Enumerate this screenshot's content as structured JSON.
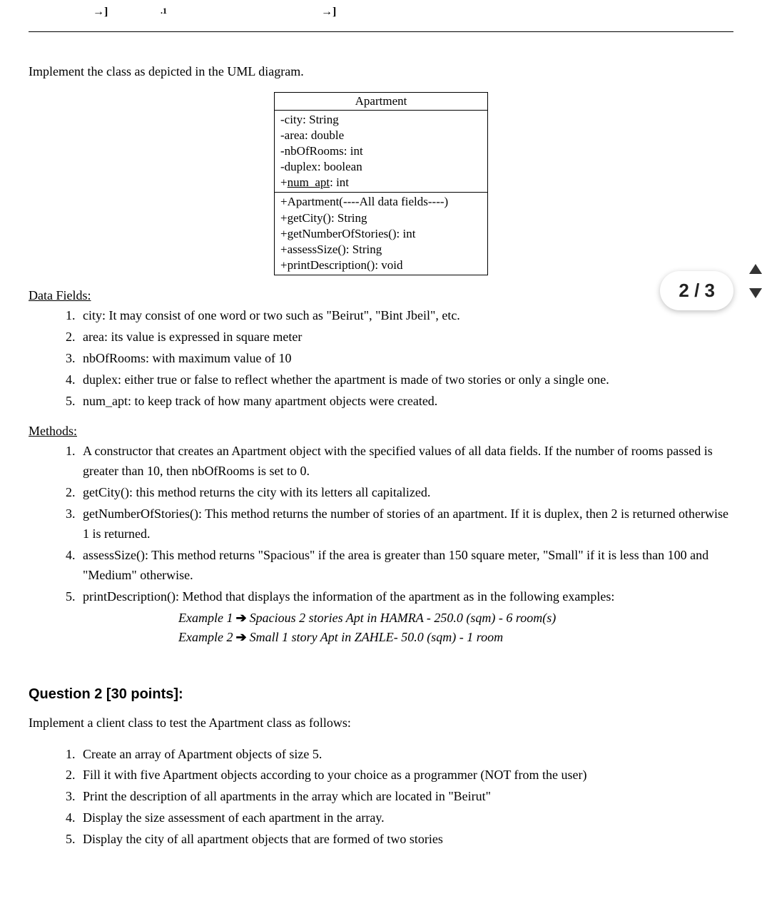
{
  "topbar": {
    "mark1": "→]",
    "mark2": ".1",
    "mark3": "→]"
  },
  "intro": "Implement the class as depicted in the UML diagram.",
  "uml": {
    "title": "Apartment",
    "fields": {
      "f1": "-city: String",
      "f2": "-area: double",
      "f3": "-nbOfRooms: int",
      "f4": "-duplex: boolean",
      "f5_pre": "+",
      "f5_under": "num_apt",
      "f5_post": ": int"
    },
    "methods": {
      "m1": "+Apartment(----All data fields----)",
      "m2": "+getCity(): String",
      "m3": "+getNumberOfStories(): int",
      "m4": "+assessSize(): String",
      "m5": "+printDescription(): void"
    }
  },
  "dataFields": {
    "heading": "Data Fields:",
    "items": {
      "1": "city: It may consist of one word or two such as \"Beirut\", \"Bint Jbeil\", etc.",
      "2": "area: its value is expressed in square meter",
      "3": "nbOfRooms: with maximum value of 10",
      "4": "duplex: either true or false to reflect whether the apartment is made of two stories or only a single one.",
      "5": "num_apt: to keep track of how many apartment objects were created."
    }
  },
  "methods": {
    "heading": "Methods:",
    "items": {
      "1": "A constructor that creates an Apartment object with the specified values of all data fields. If the number of rooms passed is greater than 10, then nbOfRooms is set to 0.",
      "2": "getCity(): this method returns the city with its letters all capitalized.",
      "3": "getNumberOfStories(): This method returns the number of stories of an apartment. If it is duplex, then 2 is returned otherwise 1 is returned.",
      "4": "assessSize(): This method returns \"Spacious\" if the area is greater than 150 square meter, \"Small\" if it is less than 100 and \"Medium\" otherwise.",
      "5": "printDescription(): Method that displays the information of the apartment as in the following examples:"
    },
    "ex1_label": "Example 1",
    "ex1_text": "Spacious 2 stories  Apt in HAMRA - 250.0 (sqm) - 6 room(s)",
    "ex2_label": "Example 2",
    "ex2_text": "Small 1 story  Apt in ZAHLE- 50.0 (sqm) - 1 room"
  },
  "q2": {
    "title": "Question 2 [30 points]:",
    "intro": "Implement a client class to test the Apartment class as follows:",
    "items": {
      "1": "Create an array of Apartment objects of size 5.",
      "2": "Fill it with five Apartment objects according to your choice as a programmer (NOT from the user)",
      "3": "Print the description of all apartments in the array which are located  in \"Beirut\"",
      "4": "Display the size assessment of each apartment in the array.",
      "5": "Display the city of all apartment objects that are formed of two stories"
    }
  },
  "pager": {
    "text": "2 / 3"
  }
}
